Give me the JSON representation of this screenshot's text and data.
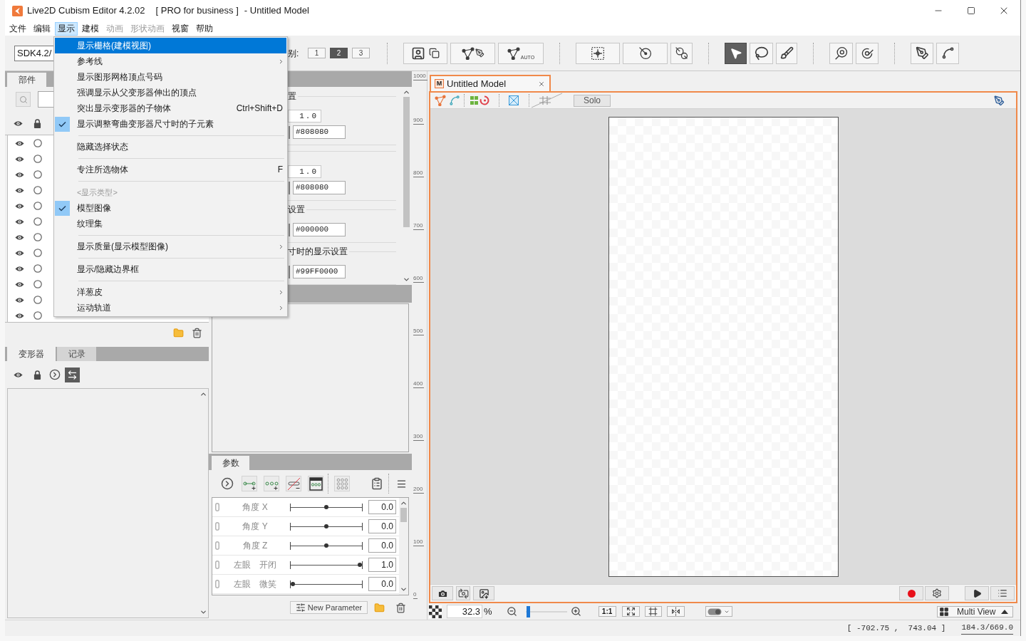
{
  "window": {
    "title": "Live2D Cubism Editor 4.2.02",
    "edition": "[ PRO for business ]",
    "document": "- Untitled Model"
  },
  "menu_bar": [
    {
      "label": "文件",
      "selected": false,
      "disabled": false
    },
    {
      "label": "编辑",
      "selected": false,
      "disabled": false
    },
    {
      "label": "显示",
      "selected": true,
      "disabled": false
    },
    {
      "label": "建模",
      "selected": false,
      "disabled": false
    },
    {
      "label": "动画",
      "selected": false,
      "disabled": true
    },
    {
      "label": "形状动画",
      "selected": false,
      "disabled": true
    },
    {
      "label": "视窗",
      "selected": false,
      "disabled": false
    },
    {
      "label": "帮助",
      "selected": false,
      "disabled": false
    }
  ],
  "display_menu": [
    {
      "kind": "item",
      "label": "显示栅格(建模视图)",
      "selected": true,
      "checked": false,
      "submenu": false
    },
    {
      "kind": "item",
      "label": "参考线",
      "selected": false,
      "checked": false,
      "submenu": true
    },
    {
      "kind": "item",
      "label": "显示图形网格顶点号码",
      "selected": false,
      "checked": false,
      "submenu": false
    },
    {
      "kind": "item",
      "label": "强调显示从父变形器伸出的顶点",
      "selected": false,
      "checked": false,
      "submenu": false
    },
    {
      "kind": "item",
      "label": "突出显示变形器的子物体",
      "shortcut": "Ctrl+Shift+D",
      "selected": false,
      "checked": false,
      "submenu": false
    },
    {
      "kind": "item",
      "label": "显示调整弯曲变形器尺寸时的子元素",
      "selected": false,
      "checked": true,
      "submenu": false
    },
    {
      "kind": "separator"
    },
    {
      "kind": "item",
      "label": "隐藏选择状态",
      "selected": false,
      "checked": false,
      "submenu": false
    },
    {
      "kind": "separator"
    },
    {
      "kind": "item",
      "label": "专注所选物体",
      "shortcut": "F",
      "selected": false,
      "checked": false,
      "submenu": false
    },
    {
      "kind": "separator"
    },
    {
      "kind": "header",
      "label": "<显示类型>"
    },
    {
      "kind": "item",
      "label": "模型图像",
      "selected": false,
      "checked": true,
      "submenu": false
    },
    {
      "kind": "item",
      "label": "纹理集",
      "selected": false,
      "checked": false,
      "submenu": false
    },
    {
      "kind": "separator"
    },
    {
      "kind": "item",
      "label": "显示质量(显示模型图像)",
      "selected": false,
      "checked": false,
      "submenu": true
    },
    {
      "kind": "separator"
    },
    {
      "kind": "item",
      "label": "显示/隐藏边界框",
      "selected": false,
      "checked": false,
      "submenu": false
    },
    {
      "kind": "separator"
    },
    {
      "kind": "item",
      "label": "洋葱皮",
      "selected": false,
      "checked": false,
      "submenu": true
    },
    {
      "kind": "item",
      "label": "运动轨道",
      "selected": false,
      "checked": false,
      "submenu": true
    }
  ],
  "toolbar": {
    "sdk_version": "SDK4.2/",
    "level_label": "别:",
    "levels": [
      {
        "label": "1",
        "selected": false
      },
      {
        "label": "2",
        "selected": true
      },
      {
        "label": "3",
        "selected": false
      }
    ],
    "tool_groups": [
      {
        "tools": [
          {
            "selected": false
          },
          {
            "selected": false
          },
          {
            "selected": false,
            "label": "AUTO"
          }
        ]
      },
      {
        "tools": [
          {
            "selected": false
          },
          {
            "selected": false
          },
          {
            "selected": false
          }
        ]
      },
      {
        "tools": [
          {
            "selected": true
          },
          {
            "selected": false
          },
          {
            "selected": false
          }
        ]
      },
      {
        "tools": [
          {
            "selected": false
          },
          {
            "selected": false
          }
        ]
      },
      {
        "tools": [
          {
            "selected": false
          },
          {
            "selected": false
          }
        ]
      }
    ]
  },
  "parts_panel": {
    "tabs": [
      {
        "label": "部件",
        "selected": true
      }
    ],
    "rows": [
      {
        "visible": true,
        "selected": false
      },
      {
        "visible": true,
        "selected": false
      },
      {
        "visible": true,
        "selected": false
      },
      {
        "visible": true,
        "selected": false
      },
      {
        "visible": true,
        "selected": false
      },
      {
        "visible": true,
        "selected": false
      },
      {
        "visible": true,
        "selected": false
      },
      {
        "visible": true,
        "selected": false
      },
      {
        "visible": true,
        "selected": false
      },
      {
        "visible": true,
        "selected": false
      },
      {
        "visible": true,
        "selected": false
      },
      {
        "visible": true,
        "selected": false
      }
    ]
  },
  "deformer_panel": {
    "tabs": [
      {
        "label": "变形器",
        "selected": true
      },
      {
        "label": "记录",
        "selected": false
      }
    ]
  },
  "inspector": {
    "groups": [
      {
        "heading": "置",
        "fields": [
          {
            "kind": "number",
            "value": "1.0"
          },
          {
            "kind": "color",
            "value": "#808080"
          }
        ]
      },
      {
        "fields": [
          {
            "kind": "number",
            "value": "1.0"
          },
          {
            "kind": "color",
            "value": "#808080"
          }
        ]
      },
      {
        "heading": "设置",
        "fields": [
          {
            "kind": "color",
            "value": "#000000"
          }
        ]
      },
      {
        "heading": "寸时的显示设置",
        "fields": [
          {
            "kind": "color",
            "value": "#99FF0000"
          }
        ]
      }
    ]
  },
  "parameters_panel": {
    "tabs": [
      {
        "label": "参数",
        "selected": true
      }
    ],
    "parameters": [
      {
        "name": "角度 X",
        "level": 0.5,
        "value": "0.0"
      },
      {
        "name": "角度 Y",
        "level": 0.5,
        "value": "0.0"
      },
      {
        "name": "角度 Z",
        "level": 0.5,
        "value": "0.0"
      },
      {
        "name": "左眼　开闭",
        "level": 1.0,
        "value": "1.0"
      },
      {
        "name": "左眼　微笑",
        "level": 0.0,
        "value": "0.0"
      }
    ],
    "new_button": "New Parameter"
  },
  "ruler": {
    "labels": [
      "1000",
      "900",
      "800",
      "700",
      "600",
      "500",
      "400",
      "300",
      "200",
      "100",
      "0"
    ]
  },
  "model_view": {
    "tab": {
      "badge": "M",
      "title": "Untitled Model",
      "selected": true
    },
    "solo_button": "Solo",
    "zoom": {
      "value": "32.3",
      "unit": "%",
      "level": 0.03
    },
    "actual_size_button": "1:1",
    "multi_view_button": "Multi View"
  },
  "status_bar": {
    "coordinates": "[ -702.75 ,  743.04 ]",
    "size": "184.3/669.0"
  }
}
